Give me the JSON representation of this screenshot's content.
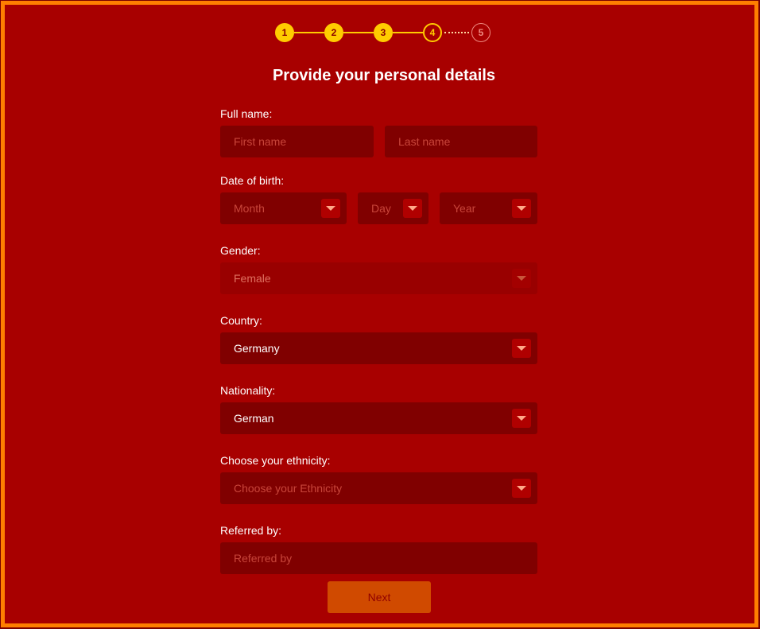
{
  "stepper": {
    "steps": [
      {
        "number": "1",
        "state": "done"
      },
      {
        "number": "2",
        "state": "done"
      },
      {
        "number": "3",
        "state": "done"
      },
      {
        "number": "4",
        "state": "current"
      },
      {
        "number": "5",
        "state": "pending"
      }
    ]
  },
  "title": "Provide your personal details",
  "form": {
    "full_name": {
      "label": "Full name:",
      "first_placeholder": "First name",
      "last_placeholder": "Last name"
    },
    "dob": {
      "label": "Date of birth:",
      "month_placeholder": "Month",
      "day_placeholder": "Day",
      "year_placeholder": "Year"
    },
    "gender": {
      "label": "Gender:",
      "value": "Female",
      "disabled": true
    },
    "country": {
      "label": "Country:",
      "value": "Germany"
    },
    "nationality": {
      "label": "Nationality:",
      "value": "German"
    },
    "ethnicity": {
      "label": "Choose your ethnicity:",
      "placeholder": "Choose your Ethnicity"
    },
    "referred_by": {
      "label": "Referred by:",
      "placeholder": "Referred by"
    }
  },
  "next_button": "Next",
  "icons": {
    "dropdown": "chevron-down-icon"
  },
  "colors": {
    "background": "#a80000",
    "border": "#ff7f00",
    "input_bg": "#800000",
    "step_active": "#ffcc00",
    "button_bg": "#d04a00"
  }
}
